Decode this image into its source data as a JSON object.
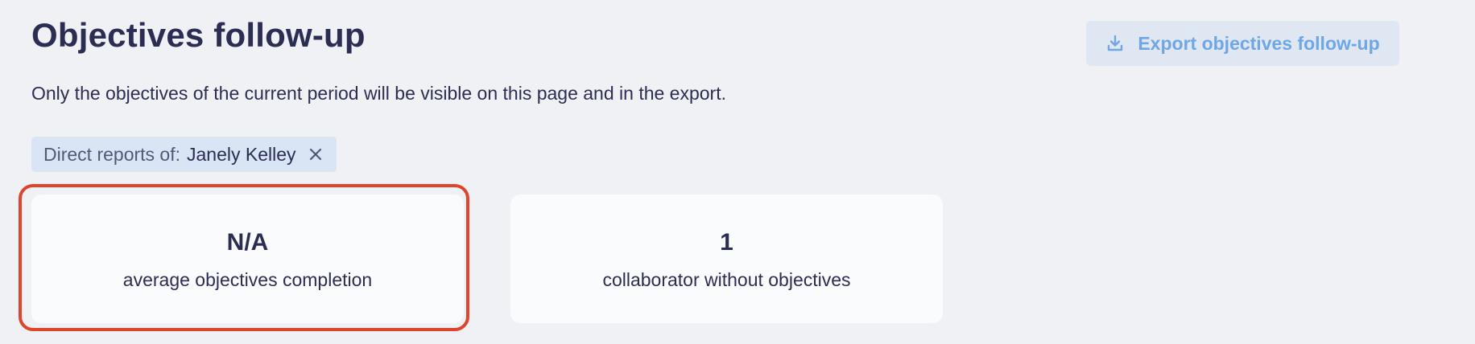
{
  "header": {
    "title": "Objectives follow-up",
    "export_label": "Export objectives follow-up",
    "export_icon": "download-icon",
    "accent_color": "#6fa6e3"
  },
  "notice": "Only the objectives of the current period will be visible on this page and in the export.",
  "filter": {
    "label": "Direct reports of:",
    "value": "Janely Kelley",
    "remove_icon": "close-icon"
  },
  "stats": [
    {
      "value": "N/A",
      "label": "average objectives completion",
      "highlighted": true
    },
    {
      "value": "1",
      "label": "collaborator without objectives",
      "highlighted": false
    }
  ],
  "highlight_color": "#e0452b"
}
